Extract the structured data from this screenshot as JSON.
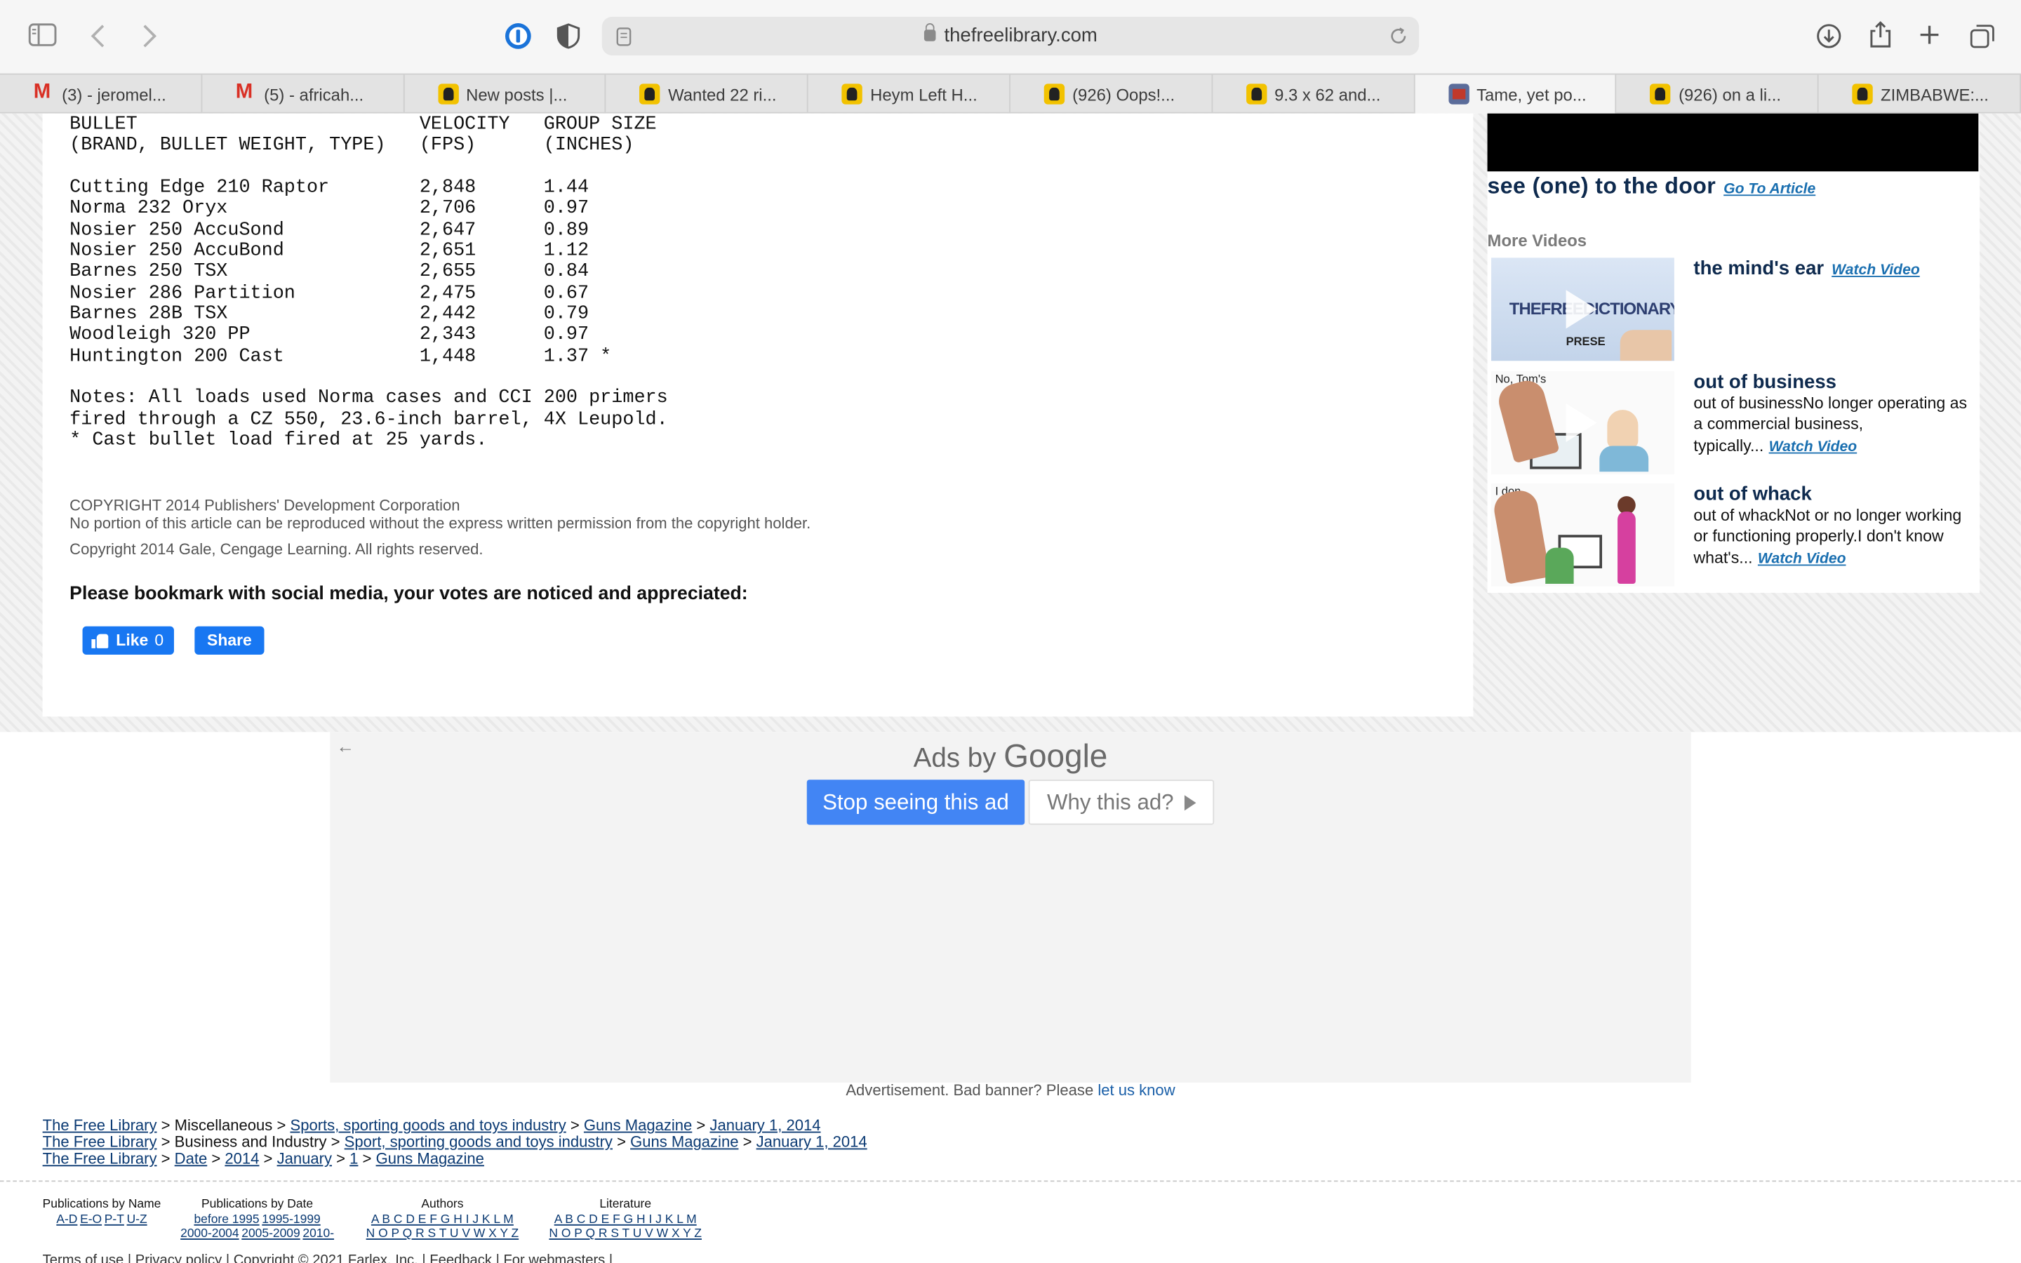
{
  "browser": {
    "url": "thefreelibrary.com",
    "tabs": [
      {
        "label": "(3) - jeromel...",
        "icon": "gmail-icon"
      },
      {
        "label": "(5) - africah...",
        "icon": "gmail-icon"
      },
      {
        "label": "New posts |...",
        "icon": "forum-icon"
      },
      {
        "label": "Wanted 22 ri...",
        "icon": "forum-icon"
      },
      {
        "label": "Heym Left H...",
        "icon": "forum-icon"
      },
      {
        "label": "(926) Oops!...",
        "icon": "forum-icon"
      },
      {
        "label": "9.3 x 62 and...",
        "icon": "forum-icon"
      },
      {
        "label": "Tame, yet po...",
        "icon": "library-icon",
        "active": true
      },
      {
        "label": "(926) on a li...",
        "icon": "forum-icon"
      },
      {
        "label": "ZIMBABWE:...",
        "icon": "forum-icon"
      }
    ]
  },
  "article": {
    "header1": {
      "bullet": "BULLET",
      "velocity": "VELOCITY",
      "group": "GROUP SIZE"
    },
    "header2": {
      "bullet": "(BRAND, BULLET WEIGHT, TYPE)",
      "velocity": "(FPS)",
      "group": "(INCHES)"
    },
    "rows": [
      {
        "bullet": "Cutting Edge 210 Raptor",
        "velocity": "2,848",
        "group": "1.44"
      },
      {
        "bullet": "Norma 232 Oryx",
        "velocity": "2,706",
        "group": "0.97"
      },
      {
        "bullet": "Nosier 250 AccuSond",
        "velocity": "2,647",
        "group": "0.89"
      },
      {
        "bullet": "Nosier 250 AccuBond",
        "velocity": "2,651",
        "group": "1.12"
      },
      {
        "bullet": "Barnes 250 TSX",
        "velocity": "2,655",
        "group": "0.84"
      },
      {
        "bullet": "Nosier 286 Partition",
        "velocity": "2,475",
        "group": "0.67"
      },
      {
        "bullet": "Barnes 28B TSX",
        "velocity": "2,442",
        "group": "0.79"
      },
      {
        "bullet": "Woodleigh 320 PP",
        "velocity": "2,343",
        "group": "0.97"
      },
      {
        "bullet": "Huntington 200 Cast",
        "velocity": "1,448",
        "group": "1.37 *"
      }
    ],
    "notes": [
      "Notes: All loads used Norma cases and CCI 200 primers",
      "fired through a CZ 550, 23.6-inch barrel, 4X Leupold.",
      "* Cast bullet load fired at 25 yards."
    ],
    "copyright_line1": "COPYRIGHT 2014 Publishers' Development Corporation",
    "copyright_line2": "No portion of this article can be reproduced without the express written permission from the copyright holder.",
    "copyright_line3": "Copyright 2014 Gale, Cengage Learning. All rights reserved.",
    "bookmark_text": "Please bookmark with social media, your votes are noticed and appreciated:",
    "like_label": "Like",
    "like_count": "0",
    "share_label": "Share"
  },
  "sidebar": {
    "headline": "see (one) to the door",
    "headline_link": "Go To Article",
    "more_videos": "More Videos",
    "videos": [
      {
        "title": "the mind's ear",
        "desc": "",
        "link": "Watch Video",
        "thumb_text": "THEFREEDICTIONARY",
        "thumb_sub": "PRESE"
      },
      {
        "title": "out of business",
        "desc": "out of businessNo longer operating as a commercial business, typically...",
        "link": "Watch Video",
        "thumb_text": "No, Tom's"
      },
      {
        "title": "out of whack",
        "desc": "out of whackNot or no longer working or functioning properly.I don't know what's...",
        "link": "Watch Video",
        "thumb_text": "I don"
      }
    ]
  },
  "ad": {
    "ads_by": "Ads by",
    "google": "Google",
    "stop_label": "Stop seeing this ad",
    "why_label": "Why this ad?",
    "note": "Advertisement. Bad banner? Please",
    "note_link": "let us know"
  },
  "breadcrumbs": [
    [
      "The Free Library",
      "Miscellaneous",
      "Sports, sporting goods and toys industry",
      "Guns Magazine",
      "January 1, 2014"
    ],
    [
      "The Free Library",
      "Business and Industry",
      "Sport, sporting goods and toys industry",
      "Guns Magazine",
      "January 1, 2014"
    ],
    [
      "The Free Library",
      "Date",
      "2014",
      "January",
      "1",
      "Guns Magazine"
    ]
  ],
  "footer": {
    "pub_by_name": {
      "heading": "Publications by Name",
      "links": [
        "A-D",
        "E-O",
        "P-T",
        "U-Z"
      ]
    },
    "pub_by_date": {
      "heading": "Publications by Date",
      "links1": [
        "before 1995",
        "1995-1999"
      ],
      "links2": [
        "2000-2004",
        "2005-2009",
        "2010-"
      ]
    },
    "authors": {
      "heading": "Authors",
      "row1": "A B C D E F G H I J K L M",
      "row2": "N O P Q R S T U V W X Y Z"
    },
    "literature": {
      "heading": "Literature",
      "row1": "A B C D E F G H I J K L M",
      "row2": "N O P Q R S T U V W X Y Z"
    },
    "bottom": "Terms of use | Privacy policy | Copyright © 2021 Farlex, Inc. | Feedback | For webmasters |"
  }
}
